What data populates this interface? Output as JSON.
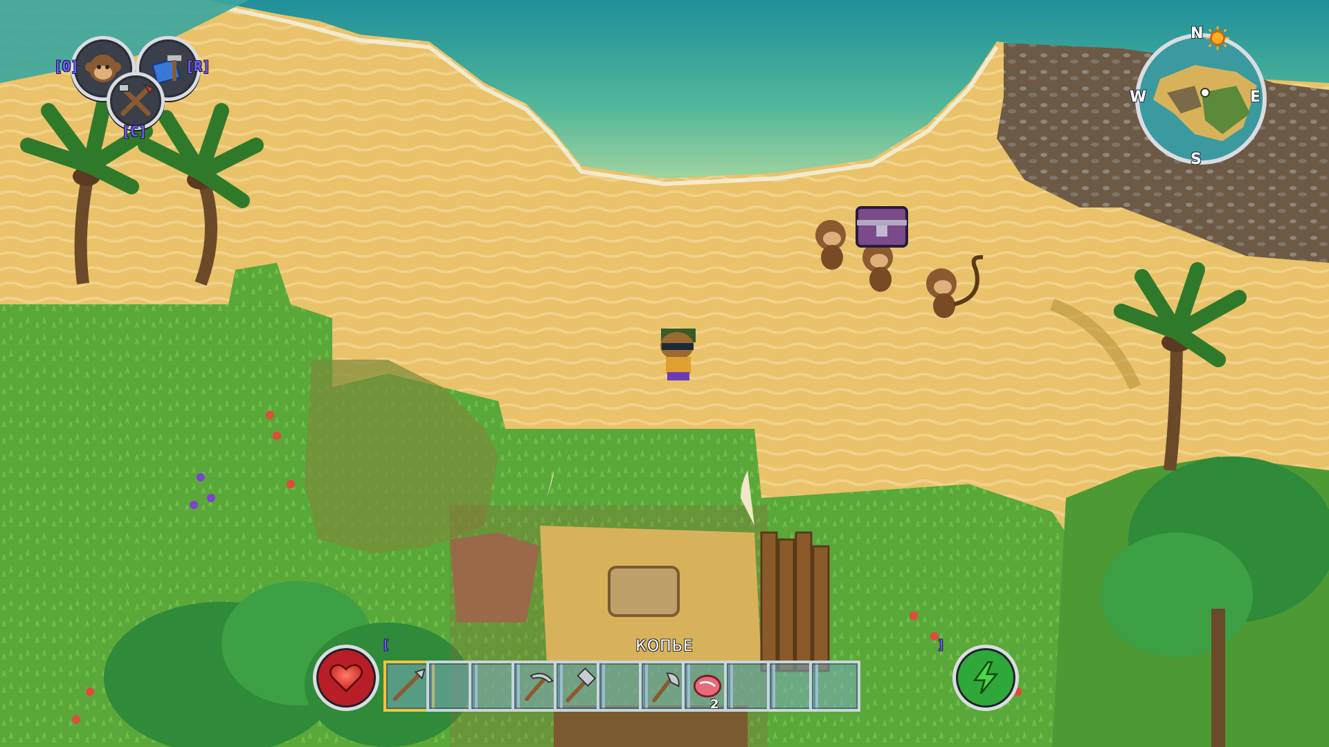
{
  "hud": {
    "companion_key": "[O]",
    "recipes_key": "[R]",
    "crafting_key": "[C]"
  },
  "compass": {
    "north": "N",
    "south": "S",
    "east": "E",
    "west": "W"
  },
  "hotbar": {
    "selected_item_label": "КОПЬЕ",
    "left_bumper": "[",
    "right_bumper": "]",
    "slots": [
      {
        "icon": "spear-icon",
        "selected": true
      },
      {
        "icon": "empty",
        "selected": false
      },
      {
        "icon": "empty",
        "selected": false
      },
      {
        "icon": "pickaxe-icon",
        "selected": false
      },
      {
        "icon": "hammer-icon",
        "selected": false
      },
      {
        "icon": "empty",
        "selected": false
      },
      {
        "icon": "axe-icon",
        "selected": false
      },
      {
        "icon": "raw-meat-icon",
        "selected": false,
        "count": "2"
      },
      {
        "icon": "empty",
        "selected": false
      },
      {
        "icon": "empty",
        "selected": false
      },
      {
        "icon": "empty",
        "selected": false
      }
    ]
  },
  "gauges": {
    "health_icon": "heart-icon",
    "energy_icon": "lightning-icon"
  },
  "colors": {
    "sand": "#e8c068",
    "ocean": "#2fa89a",
    "grass": "#5aa83a",
    "hotbar_selected": "#f2c53a",
    "key_hint": "#6a5cff"
  }
}
